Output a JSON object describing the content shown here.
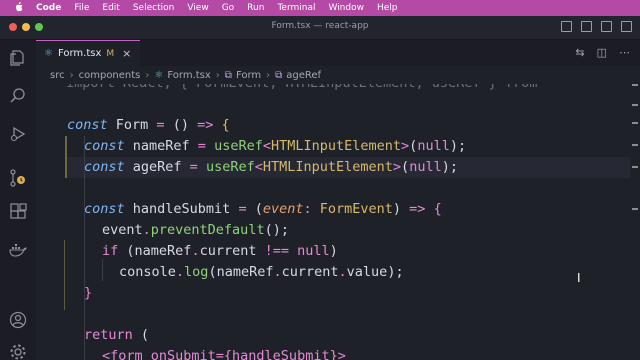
{
  "menubar": {
    "items": [
      "Code",
      "File",
      "Edit",
      "Selection",
      "View",
      "Go",
      "Run",
      "Terminal",
      "Window",
      "Help"
    ]
  },
  "window": {
    "title": "Form.tsx — react-app"
  },
  "tab": {
    "filename": "Form.tsx",
    "status": "M"
  },
  "breadcrumb": [
    "src",
    "components",
    "Form.tsx",
    "Form",
    "ageRef"
  ],
  "code": {
    "line0": "import React, { FormEvent, HTMLInputElement, useRef } from",
    "line1": [
      {
        "t": "const",
        "c": "kw"
      },
      {
        "t": " Form ",
        "c": "id"
      },
      {
        "t": "=",
        "c": "op"
      },
      {
        "t": " () ",
        "c": "id"
      },
      {
        "t": "=>",
        "c": "op"
      },
      {
        "t": " {",
        "c": "ty"
      }
    ],
    "line2": [
      {
        "t": "const",
        "c": "kw"
      },
      {
        "t": " nameRef ",
        "c": "id"
      },
      {
        "t": "=",
        "c": "op"
      },
      {
        "t": " useRef",
        "c": "fn"
      },
      {
        "t": "<",
        "c": "op"
      },
      {
        "t": "HTMLInputElement",
        "c": "ty"
      },
      {
        "t": ">",
        "c": "op"
      },
      {
        "t": "(",
        "c": "pr"
      },
      {
        "t": "null",
        "c": "nl"
      },
      {
        "t": ");",
        "c": "pr"
      }
    ],
    "line3": [
      {
        "t": "const",
        "c": "kw"
      },
      {
        "t": " ageRef ",
        "c": "id"
      },
      {
        "t": "=",
        "c": "op"
      },
      {
        "t": " useRef",
        "c": "fn"
      },
      {
        "t": "<",
        "c": "op"
      },
      {
        "t": "HTMLInputElement",
        "c": "ty"
      },
      {
        "t": ">",
        "c": "op"
      },
      {
        "t": "(",
        "c": "pr"
      },
      {
        "t": "null",
        "c": "nl"
      },
      {
        "t": ");",
        "c": "pr"
      }
    ],
    "line5": [
      {
        "t": "const",
        "c": "kw"
      },
      {
        "t": " handleSubmit ",
        "c": "id"
      },
      {
        "t": "=",
        "c": "op"
      },
      {
        "t": " (",
        "c": "pr"
      },
      {
        "t": "event",
        "c": "pa"
      },
      {
        "t": ": ",
        "c": "op"
      },
      {
        "t": "FormEvent",
        "c": "ty"
      },
      {
        "t": ") ",
        "c": "pr"
      },
      {
        "t": "=>",
        "c": "op"
      },
      {
        "t": " {",
        "c": "op"
      }
    ],
    "line6": [
      {
        "t": "event",
        "c": "id"
      },
      {
        "t": ".",
        "c": "op"
      },
      {
        "t": "preventDefault",
        "c": "fn"
      },
      {
        "t": "();",
        "c": "pr"
      }
    ],
    "line7": [
      {
        "t": "if",
        "c": "op"
      },
      {
        "t": " (",
        "c": "pr"
      },
      {
        "t": "nameRef",
        "c": "id"
      },
      {
        "t": ".",
        "c": "op"
      },
      {
        "t": "current ",
        "c": "id"
      },
      {
        "t": "!==",
        "c": "op"
      },
      {
        "t": " null",
        "c": "nl"
      },
      {
        "t": ")",
        "c": "pr"
      }
    ],
    "line8": [
      {
        "t": "console",
        "c": "id"
      },
      {
        "t": ".",
        "c": "op"
      },
      {
        "t": "log",
        "c": "fn"
      },
      {
        "t": "(",
        "c": "pr"
      },
      {
        "t": "nameRef",
        "c": "id"
      },
      {
        "t": ".",
        "c": "op"
      },
      {
        "t": "current",
        "c": "id"
      },
      {
        "t": ".",
        "c": "op"
      },
      {
        "t": "value",
        "c": "id"
      },
      {
        "t": ");",
        "c": "pr"
      }
    ],
    "line9": [
      {
        "t": "}",
        "c": "op"
      }
    ],
    "line11": [
      {
        "t": "return",
        "c": "op"
      },
      {
        "t": " (",
        "c": "pr"
      }
    ],
    "line12": "<form onSubmit={handleSubmit}>"
  },
  "colors": {
    "menubar": "#b44aa6",
    "editor_bg": "#1f2129",
    "accent_tab": "#c766c2"
  }
}
